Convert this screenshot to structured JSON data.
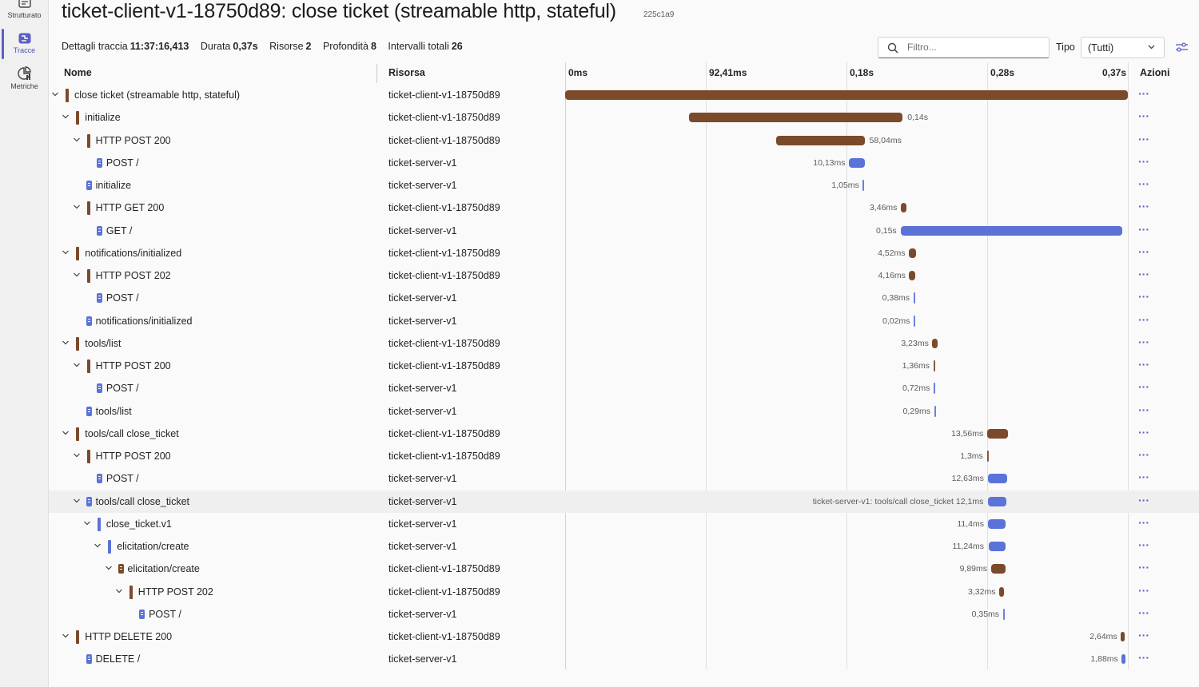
{
  "nav": {
    "items": [
      {
        "label": "Strutturato",
        "icon": "structured-logs-icon"
      },
      {
        "label": "Tracce",
        "icon": "traces-icon",
        "active": true
      },
      {
        "label": "Metriche",
        "icon": "metrics-icon"
      }
    ]
  },
  "header": {
    "title": "ticket-client-v1-18750d89: close ticket (streamable http, stateful)",
    "trace_id": "225c1a9",
    "summary": [
      {
        "key": "Dettagli traccia",
        "value": "11:37:16,413"
      },
      {
        "key": "Durata",
        "value": "0,37s"
      },
      {
        "key": "Risorse",
        "value": "2"
      },
      {
        "key": "Profondità",
        "value": "8"
      },
      {
        "key": "Intervalli totali",
        "value": "26"
      }
    ]
  },
  "toolbar": {
    "filter_placeholder": "Filtro...",
    "type_label": "Tipo",
    "type_value": "(Tutti)"
  },
  "columns": {
    "name": "Nome",
    "resource": "Risorsa",
    "actions": "Azioni",
    "ticks": [
      "0ms",
      "92,41ms",
      "0,18s",
      "0,28s",
      "0,37s"
    ]
  },
  "timeline": {
    "total_ms": 369.6
  },
  "colors": {
    "client": "#7b4a2b",
    "server": "#5b73d8",
    "accent": "#5b5fc7"
  },
  "spans": [
    {
      "name": "close ticket (streamable http, stateful)",
      "resource": "ticket-client-v1-18750d89",
      "depth": 0,
      "expanded": true,
      "kind": "client",
      "start_ms": 0,
      "duration_ms": 369.6,
      "label": ""
    },
    {
      "name": "initialize",
      "resource": "ticket-client-v1-18750d89",
      "depth": 1,
      "expanded": true,
      "kind": "client",
      "start_ms": 81.5,
      "duration_ms": 140.2,
      "label": "0,14s"
    },
    {
      "name": "HTTP POST 200",
      "resource": "ticket-client-v1-18750d89",
      "depth": 2,
      "expanded": true,
      "kind": "client",
      "start_ms": 138.6,
      "duration_ms": 58.04,
      "label": "58,04ms"
    },
    {
      "name": "POST /",
      "resource": "ticket-server-v1",
      "depth": 3,
      "kind": "server-doc",
      "start_ms": 186.5,
      "duration_ms": 10.13,
      "label": "10,13ms"
    },
    {
      "name": "initialize",
      "resource": "ticket-server-v1",
      "depth": 2,
      "kind": "server-doc",
      "start_ms": 195.5,
      "duration_ms": 1.05,
      "label": "1,05ms"
    },
    {
      "name": "HTTP GET 200",
      "resource": "ticket-client-v1-18750d89",
      "depth": 2,
      "expanded": true,
      "kind": "client",
      "start_ms": 220.5,
      "duration_ms": 3.46,
      "label": "3,46ms"
    },
    {
      "name": "GET /",
      "resource": "ticket-server-v1",
      "depth": 3,
      "kind": "server-doc",
      "start_ms": 220.5,
      "duration_ms": 145.6,
      "label": "0,15s"
    },
    {
      "name": "notifications/initialized",
      "resource": "ticket-client-v1-18750d89",
      "depth": 1,
      "expanded": true,
      "kind": "client",
      "start_ms": 225.8,
      "duration_ms": 4.52,
      "label": "4,52ms"
    },
    {
      "name": "HTTP POST 202",
      "resource": "ticket-client-v1-18750d89",
      "depth": 2,
      "expanded": true,
      "kind": "client",
      "start_ms": 226.0,
      "duration_ms": 4.16,
      "label": "4,16ms"
    },
    {
      "name": "POST /",
      "resource": "ticket-server-v1",
      "depth": 3,
      "kind": "server-doc",
      "start_ms": 228.7,
      "duration_ms": 0.38,
      "label": "0,38ms"
    },
    {
      "name": "notifications/initialized",
      "resource": "ticket-server-v1",
      "depth": 2,
      "kind": "server-doc",
      "start_ms": 228.9,
      "duration_ms": 0.02,
      "label": "0,02ms"
    },
    {
      "name": "tools/list",
      "resource": "ticket-client-v1-18750d89",
      "depth": 1,
      "expanded": true,
      "kind": "client",
      "start_ms": 241.2,
      "duration_ms": 3.23,
      "label": "3,23ms"
    },
    {
      "name": "HTTP POST 200",
      "resource": "ticket-client-v1-18750d89",
      "depth": 2,
      "expanded": true,
      "kind": "client",
      "start_ms": 241.8,
      "duration_ms": 1.36,
      "label": "1,36ms"
    },
    {
      "name": "POST /",
      "resource": "ticket-server-v1",
      "depth": 3,
      "kind": "server-doc",
      "start_ms": 242.0,
      "duration_ms": 0.72,
      "label": "0,72ms"
    },
    {
      "name": "tools/list",
      "resource": "ticket-server-v1",
      "depth": 2,
      "kind": "server-doc",
      "start_ms": 242.3,
      "duration_ms": 0.29,
      "label": "0,29ms"
    },
    {
      "name": "tools/call close_ticket",
      "resource": "ticket-client-v1-18750d89",
      "depth": 1,
      "expanded": true,
      "kind": "client",
      "start_ms": 277.2,
      "duration_ms": 13.56,
      "label": "13,56ms"
    },
    {
      "name": "HTTP POST 200",
      "resource": "ticket-client-v1-18750d89",
      "depth": 2,
      "expanded": true,
      "kind": "client",
      "start_ms": 277.3,
      "duration_ms": 1.3,
      "label": "1,3ms"
    },
    {
      "name": "POST /",
      "resource": "ticket-server-v1",
      "depth": 3,
      "kind": "server-doc",
      "start_ms": 277.5,
      "duration_ms": 12.63,
      "label": "12,63ms"
    },
    {
      "name": "tools/call close_ticket",
      "resource": "ticket-server-v1",
      "depth": 2,
      "expanded": true,
      "kind": "server-doc",
      "start_ms": 277.6,
      "duration_ms": 12.1,
      "label": "ticket-server-v1: tools/call close_ticket 12,1ms",
      "highlight": true
    },
    {
      "name": "close_ticket.v1",
      "resource": "ticket-server-v1",
      "depth": 3,
      "expanded": true,
      "kind": "server",
      "start_ms": 277.9,
      "duration_ms": 11.4,
      "label": "11,4ms"
    },
    {
      "name": "elicitation/create",
      "resource": "ticket-server-v1",
      "depth": 4,
      "expanded": true,
      "kind": "server",
      "start_ms": 278.0,
      "duration_ms": 11.24,
      "label": "11,24ms"
    },
    {
      "name": "elicitation/create",
      "resource": "ticket-client-v1-18750d89",
      "depth": 5,
      "expanded": true,
      "kind": "client-doc",
      "start_ms": 279.6,
      "duration_ms": 9.89,
      "label": "9,89ms"
    },
    {
      "name": "HTTP POST 202",
      "resource": "ticket-client-v1-18750d89",
      "depth": 6,
      "expanded": true,
      "kind": "client",
      "start_ms": 285.1,
      "duration_ms": 3.32,
      "label": "3,32ms"
    },
    {
      "name": "POST /",
      "resource": "ticket-server-v1",
      "depth": 7,
      "kind": "server-doc",
      "start_ms": 287.5,
      "duration_ms": 0.35,
      "label": "0,35ms"
    },
    {
      "name": "HTTP DELETE 200",
      "resource": "ticket-client-v1-18750d89",
      "depth": 1,
      "expanded": true,
      "kind": "client",
      "start_ms": 365.0,
      "duration_ms": 2.64,
      "label": "2,64ms"
    },
    {
      "name": "DELETE /",
      "resource": "ticket-server-v1",
      "depth": 2,
      "kind": "server-doc",
      "start_ms": 365.6,
      "duration_ms": 1.88,
      "label": "1,88ms"
    }
  ]
}
